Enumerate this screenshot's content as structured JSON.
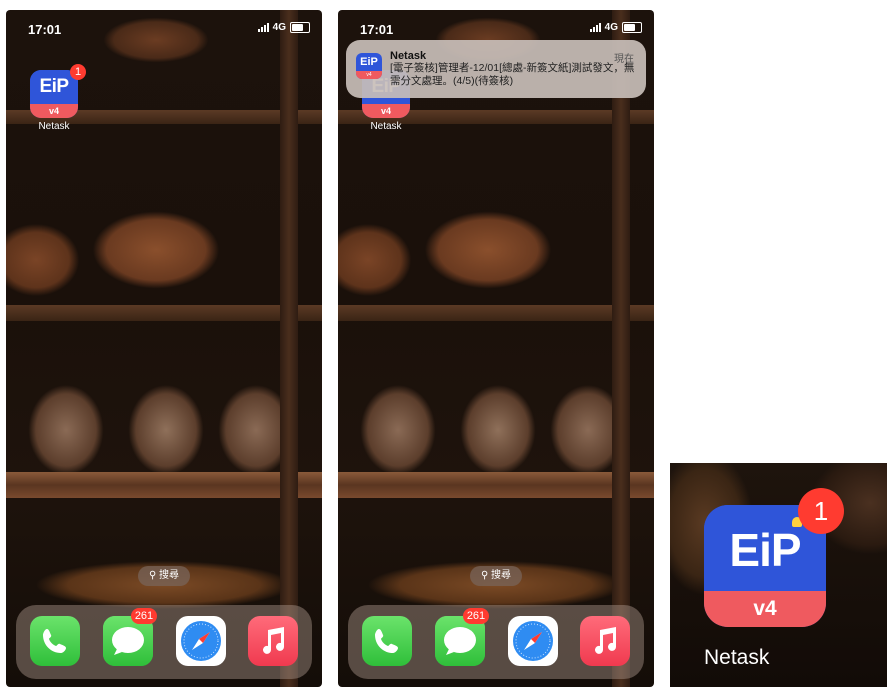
{
  "colors": {
    "eip_blue": "#2f55d9",
    "eip_red": "#ef5a5f",
    "badge_red": "#ff3b30"
  },
  "status_bar": {
    "time": "17:01",
    "network": "4G"
  },
  "app": {
    "logo_text": "EiP",
    "version_text": "v4",
    "label": "Netask",
    "badge": "1"
  },
  "search": {
    "label": "搜尋"
  },
  "dock": {
    "items": [
      {
        "name": "phone",
        "icon": "phone-icon"
      },
      {
        "name": "messages",
        "icon": "message-bubble-icon",
        "badge": "261"
      },
      {
        "name": "safari",
        "icon": "compass-icon"
      },
      {
        "name": "music",
        "icon": "music-note-icon"
      }
    ]
  },
  "notification": {
    "app_name": "Netask",
    "time": "現在",
    "body": "[電子簽核]管理者-12/01[總處-新簽文紙]測試發文，無需分文處理。(4/5)(待簽核)"
  }
}
